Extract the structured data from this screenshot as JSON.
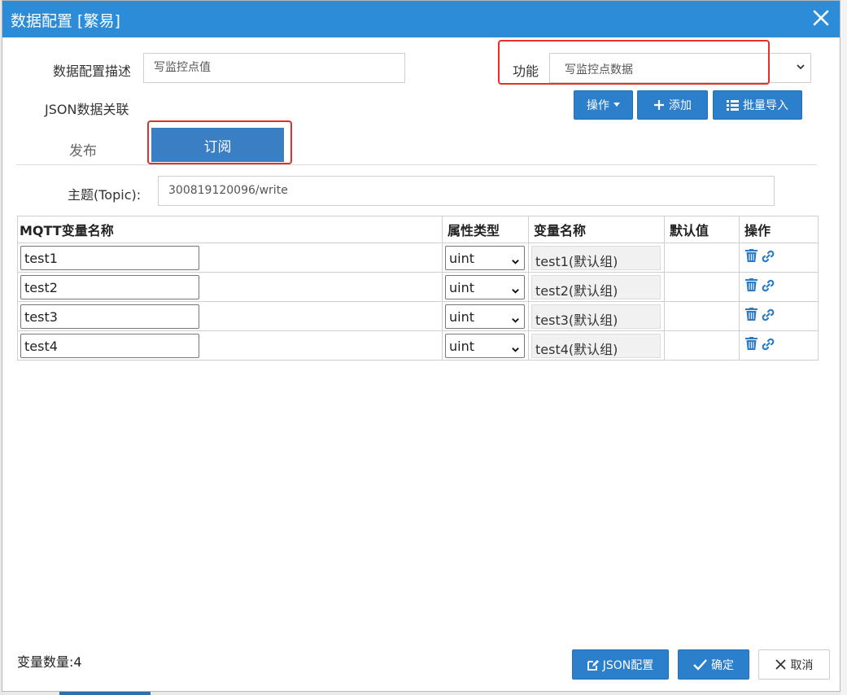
{
  "dialog": {
    "title": "数据配置 [繁易]"
  },
  "form": {
    "desc_label": "数据配置描述",
    "desc_value": "写监控点值",
    "function_label": "功能",
    "function_value": "写监控点数据",
    "json_label": "JSON数据关联"
  },
  "toolbar": {
    "operate_label": "操作",
    "add_label": "添加",
    "import_label": "批量导入"
  },
  "tabs": {
    "publish": "发布",
    "subscribe": "订阅"
  },
  "topic": {
    "label": "主题(Topic):",
    "value": "300819120096/write"
  },
  "table": {
    "headers": [
      "MQTT变量名称",
      "属性类型",
      "变量名称",
      "默认值",
      "操作"
    ],
    "rows": [
      {
        "mqtt_name": "test1",
        "type": "uint",
        "var_name": "test1(默认组)",
        "default": ""
      },
      {
        "mqtt_name": "test2",
        "type": "uint",
        "var_name": "test2(默认组)",
        "default": ""
      },
      {
        "mqtt_name": "test3",
        "type": "uint",
        "var_name": "test3(默认组)",
        "default": ""
      },
      {
        "mqtt_name": "test4",
        "type": "uint",
        "var_name": "test4(默认组)",
        "default": ""
      }
    ]
  },
  "footer": {
    "count_label": "变量数量:4",
    "json_config_label": "JSON配置",
    "confirm_label": "确定",
    "cancel_label": "取消"
  },
  "colors": {
    "primary": "#2b7fcb",
    "titlebar": "#2d8cd8",
    "highlight": "#e0312c"
  },
  "icons": [
    "close-icon",
    "caret-down-icon",
    "plus-icon",
    "list-icon",
    "trash-icon",
    "link-icon",
    "edit-icon",
    "check-icon",
    "x-icon"
  ]
}
